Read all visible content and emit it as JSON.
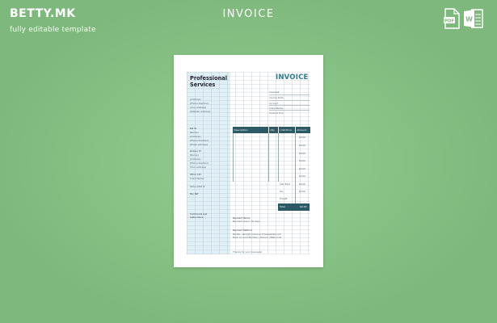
{
  "brand": {
    "logo": "BETTY.MK",
    "tagline": "fully editable template"
  },
  "page": {
    "heading": "INVOICE"
  },
  "file_icons": [
    {
      "name": "pdf-icon",
      "label": "PDF",
      "color": "#ffffff"
    },
    {
      "name": "word-icon",
      "label": "W",
      "color": "#ffffff"
    }
  ],
  "colors": {
    "background": "#82bd80",
    "accent": "#2c5966",
    "title": "#2f7d8e"
  },
  "document": {
    "company": "Professional Services",
    "title": "INVOICE",
    "company_fields": [
      "[Address]",
      "[Phone Number]",
      "[Your Address]",
      "[Website Address]"
    ],
    "meta_fields": [
      "Invoice#",
      "Invoice Date",
      "Account",
      "Client Name",
      "Amount Due"
    ],
    "bill_to": [
      "Bill To",
      "[Name]",
      "[Address]",
      "[Phone Number]",
      "[Email address]"
    ],
    "deliver_to": [
      "Deliver To",
      "[Name]",
      "[Address]",
      "[Phone Number]",
      "[Your Address]"
    ],
    "other_fields": [
      "Other Info",
      "Client Name",
      "Refund/Ref #",
      "Pay Ref"
    ],
    "columns": [
      "Description",
      "Qty",
      "Unit Price",
      "Amount"
    ],
    "amounts": [
      "$0.00",
      "$0.00",
      "$0.00",
      "$0.00",
      "$0.00",
      "$0.00"
    ],
    "summary": [
      {
        "label": "Sub Total",
        "value": "$0.00"
      },
      {
        "label": "Tax",
        "value": "$0.00"
      },
      {
        "label": "Freight",
        "value": ""
      }
    ],
    "total": {
      "label": "Total",
      "value": "$0.00"
    },
    "comments_label": "Comments and Instructions",
    "payment_terms": [
      "Payment Terms",
      "Payment due in 30 days"
    ],
    "payment_method": [
      "Payment Method",
      "PayPal: name@companynamewebsite.com",
      "Bank Account Number | Branch | BSB Code"
    ],
    "thanks": "Thanks for your business!"
  }
}
